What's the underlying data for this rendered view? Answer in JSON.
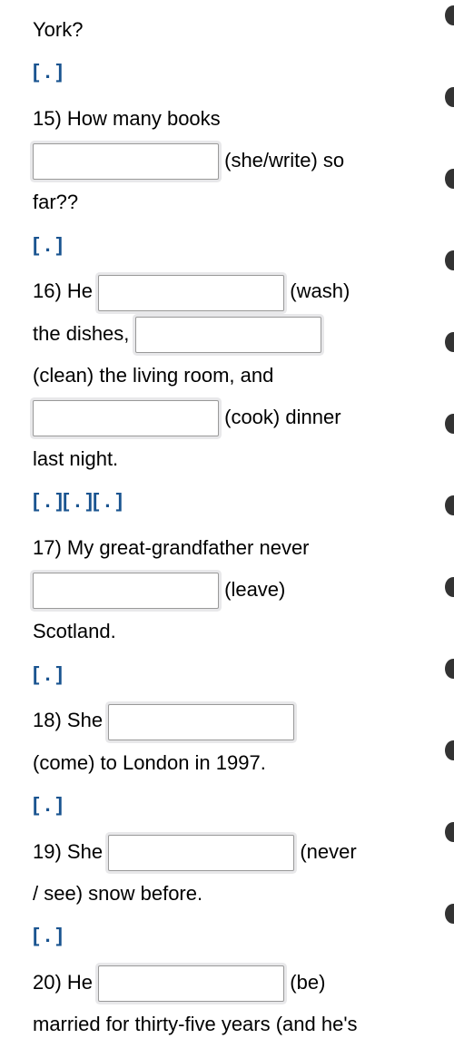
{
  "q14": {
    "fragment_end": "York?",
    "hint": "[ . ]"
  },
  "q15": {
    "number": "15)",
    "text_before": "How many books",
    "prompt": "(she/write) so",
    "text_after": "far??",
    "hint": "[ . ]"
  },
  "q16": {
    "number": "16)",
    "text1": "He",
    "prompt1": "(wash)",
    "text2": "the dishes,",
    "text3": "(clean) the living room, and",
    "prompt3": "(cook) dinner",
    "text4": "last night.",
    "hint": "[ . ][ . ][ . ]"
  },
  "q17": {
    "number": "17)",
    "text1": "My great-grandfather never",
    "prompt": "(leave)",
    "text2": "Scotland.",
    "hint": "[ . ]"
  },
  "q18": {
    "number": "18)",
    "text1": "She",
    "text2": "(come) to London in 1997.",
    "hint": "[ . ]"
  },
  "q19": {
    "number": "19)",
    "text1": "She",
    "prompt": "(never",
    "text2": "/ see) snow before.",
    "hint": "[ . ]"
  },
  "q20": {
    "number": "20)",
    "text1": "He",
    "prompt": "(be)",
    "text2": "married for thirty-five years (and he's"
  }
}
